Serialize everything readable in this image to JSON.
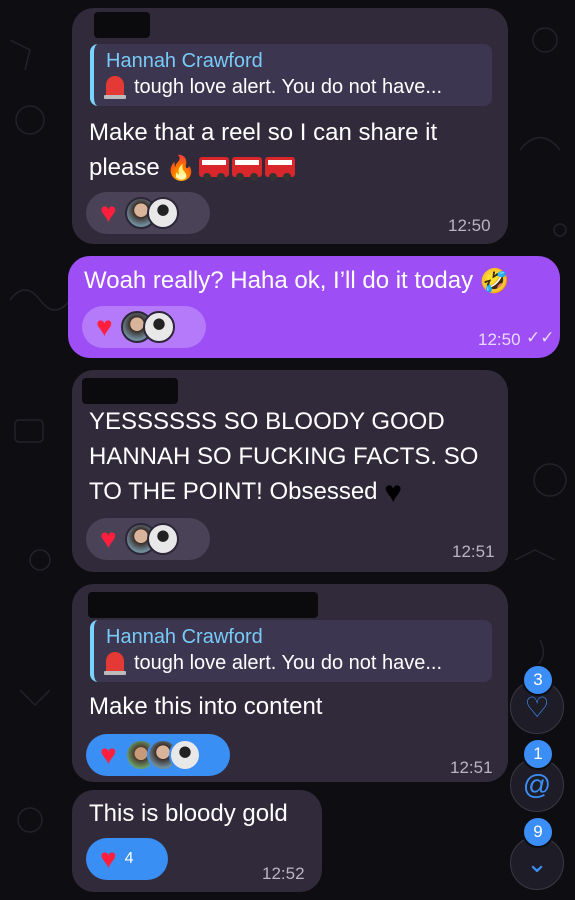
{
  "messages": [
    {
      "quote_name": "Hannah Crawford",
      "quote_text": "tough love alert. You do not have...",
      "text_line1": "Make that a reel so I can share it",
      "text_line2": "please",
      "time": "12:50"
    },
    {
      "text": "Woah really? Haha ok, I’ll do it today",
      "time": "12:50"
    },
    {
      "text_line1": "YESSSSSS  SO BLOODY GOOD",
      "text_line2": "HANNAH SO FUCKING FACTS. SO",
      "text_line3": "TO THE POINT! Obsessed",
      "time": "12:51"
    },
    {
      "quote_name": "Hannah Crawford",
      "quote_text": "tough love alert. You do not have...",
      "text": "Make this into content",
      "time": "12:51"
    },
    {
      "text": "This is bloody gold",
      "reaction_count": "4",
      "time": "12:52"
    }
  ],
  "side_buttons": {
    "reactions_badge": "3",
    "mentions_badge": "1",
    "unread_badge": "9"
  },
  "colors": {
    "incoming_bubble": "#302a3a",
    "outgoing_bubble": "#9d4ff5",
    "accent": "#3b8ef5",
    "heart": "#ff1f3d"
  }
}
